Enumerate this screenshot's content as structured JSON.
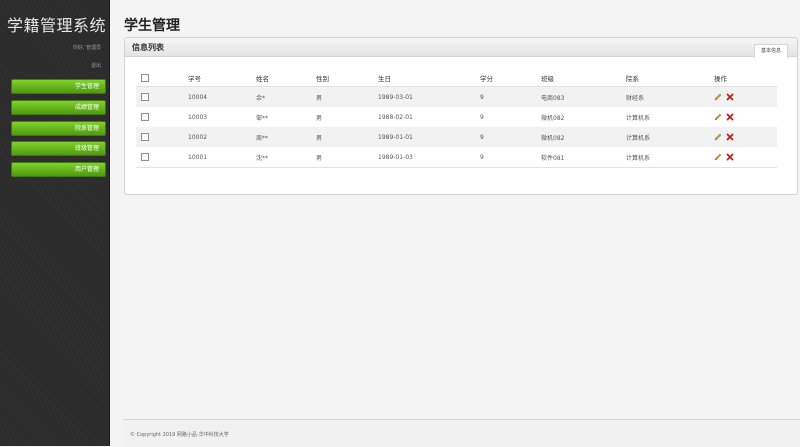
{
  "sidebar": {
    "app_title": "学籍管理系统",
    "greeting": "你好, 管理员",
    "logout": "退出",
    "items": [
      {
        "label": "学生管理"
      },
      {
        "label": "成绩管理"
      },
      {
        "label": "院系管理"
      },
      {
        "label": "班级管理"
      },
      {
        "label": "用户管理"
      }
    ]
  },
  "main": {
    "page_title": "学生管理",
    "panel": {
      "title": "信息列表",
      "tab": "基本信息"
    },
    "table": {
      "headers": [
        "学号",
        "姓名",
        "性别",
        "生日",
        "学分",
        "班级",
        "院系",
        "操作"
      ],
      "rows": [
        [
          "10004",
          "余*",
          "男",
          "1989-03-01",
          "9",
          "电商083",
          "财经系"
        ],
        [
          "10003",
          "邹**",
          "男",
          "1988-02-01",
          "9",
          "微机082",
          "计算机系"
        ],
        [
          "10002",
          "周**",
          "男",
          "1989-01-01",
          "9",
          "微机082",
          "计算机系"
        ],
        [
          "10001",
          "沈**",
          "男",
          "1989-01-03",
          "9",
          "软件081",
          "计算机系"
        ]
      ]
    }
  },
  "footer": {
    "text": "© Copyright 2019 网路小品-华中科技大学"
  },
  "icons": {
    "edit": "pencil-icon",
    "delete": "delete-x-icon",
    "checkbox": "checkbox"
  },
  "colors": {
    "nav_accent": "#6cc01d",
    "sidebar_bg": "#2b2b2b",
    "delete_red": "#c0201a",
    "gender_green": "#6aa313"
  }
}
